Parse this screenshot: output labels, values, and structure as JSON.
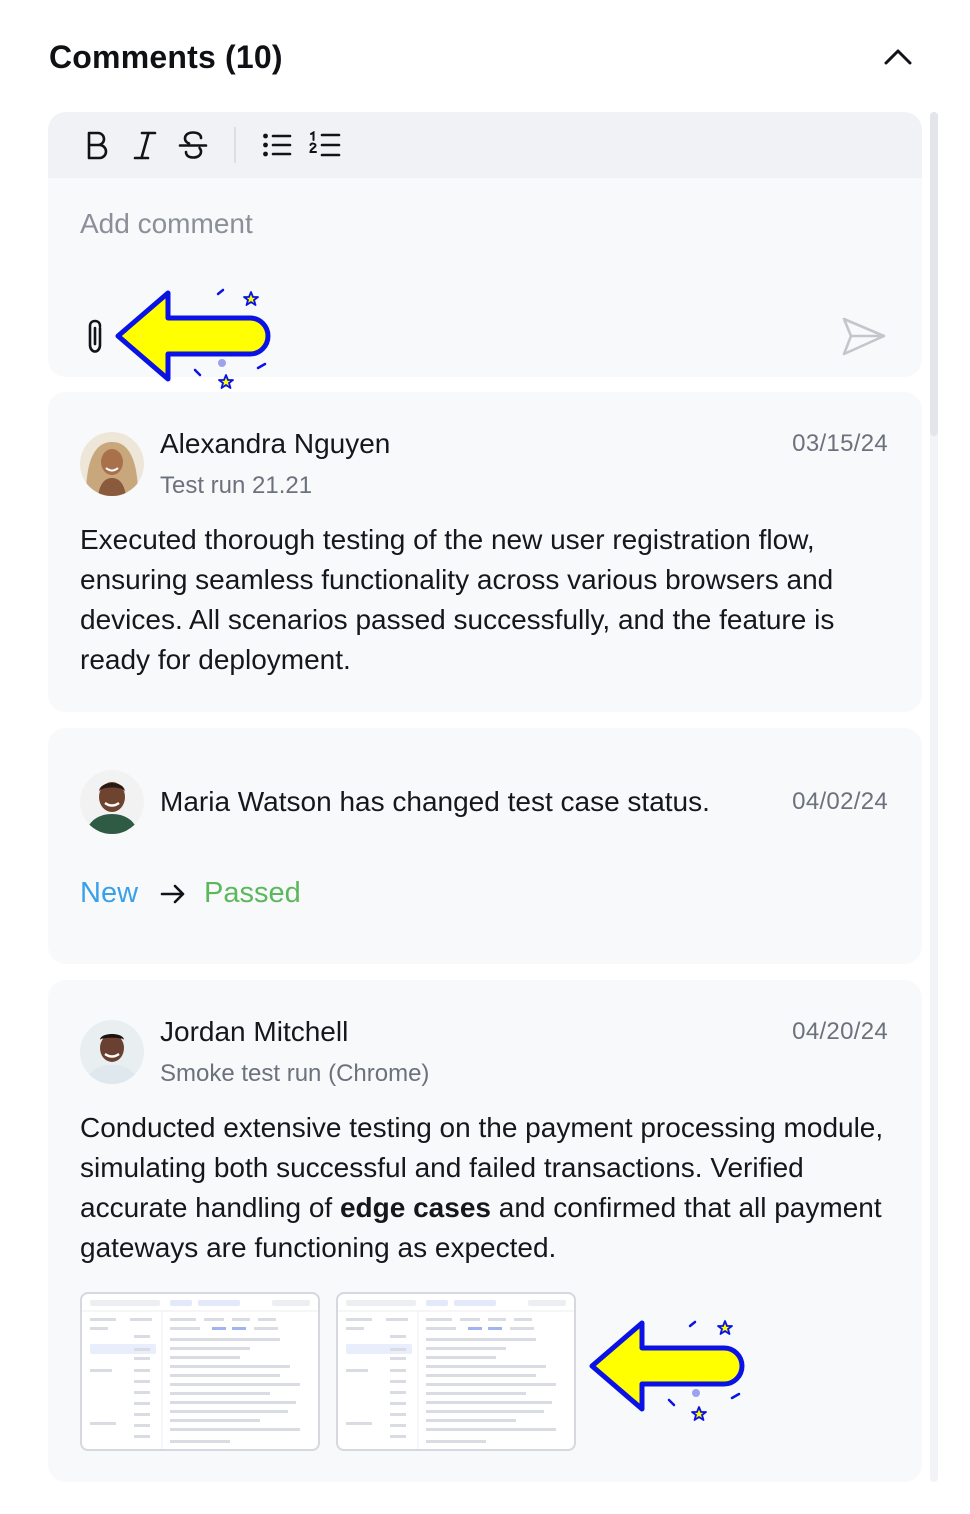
{
  "header": {
    "title": "Comments (10)"
  },
  "editor": {
    "placeholder": "Add comment",
    "toolbar": [
      "bold-icon",
      "italic-icon",
      "strikethrough-icon",
      "bullet-list-icon",
      "numbered-list-icon"
    ],
    "accent": "#FFFF00",
    "accent_outline": "#0A12E6"
  },
  "comments": [
    {
      "author": "Alexandra Nguyen",
      "subtitle": "Test run 21.21",
      "date": "03/15/24",
      "body": "Executed thorough testing of the new user registration flow, ensuring seamless functionality across various browsers and devices. All scenarios passed successfully, and the feature is ready for deployment."
    },
    {
      "message": "Maria Watson has changed test case status.",
      "date": "04/02/24",
      "status_from": "New",
      "status_to": "Passed",
      "status_from_color": "#3AA0E8",
      "status_to_color": "#5CB85C"
    },
    {
      "author": "Jordan Mitchell",
      "subtitle": "Smoke test run (Chrome)",
      "date": "04/20/24",
      "body_before": "Conducted extensive testing on the payment processing module, simulating both successful and failed transactions. Verified accurate handling of ",
      "body_bold": "edge cases",
      "body_after": " and confirmed that all payment gateways are functioning as expected.",
      "attachments": [
        "screenshot-thumbnail",
        "screenshot-thumbnail"
      ]
    }
  ]
}
